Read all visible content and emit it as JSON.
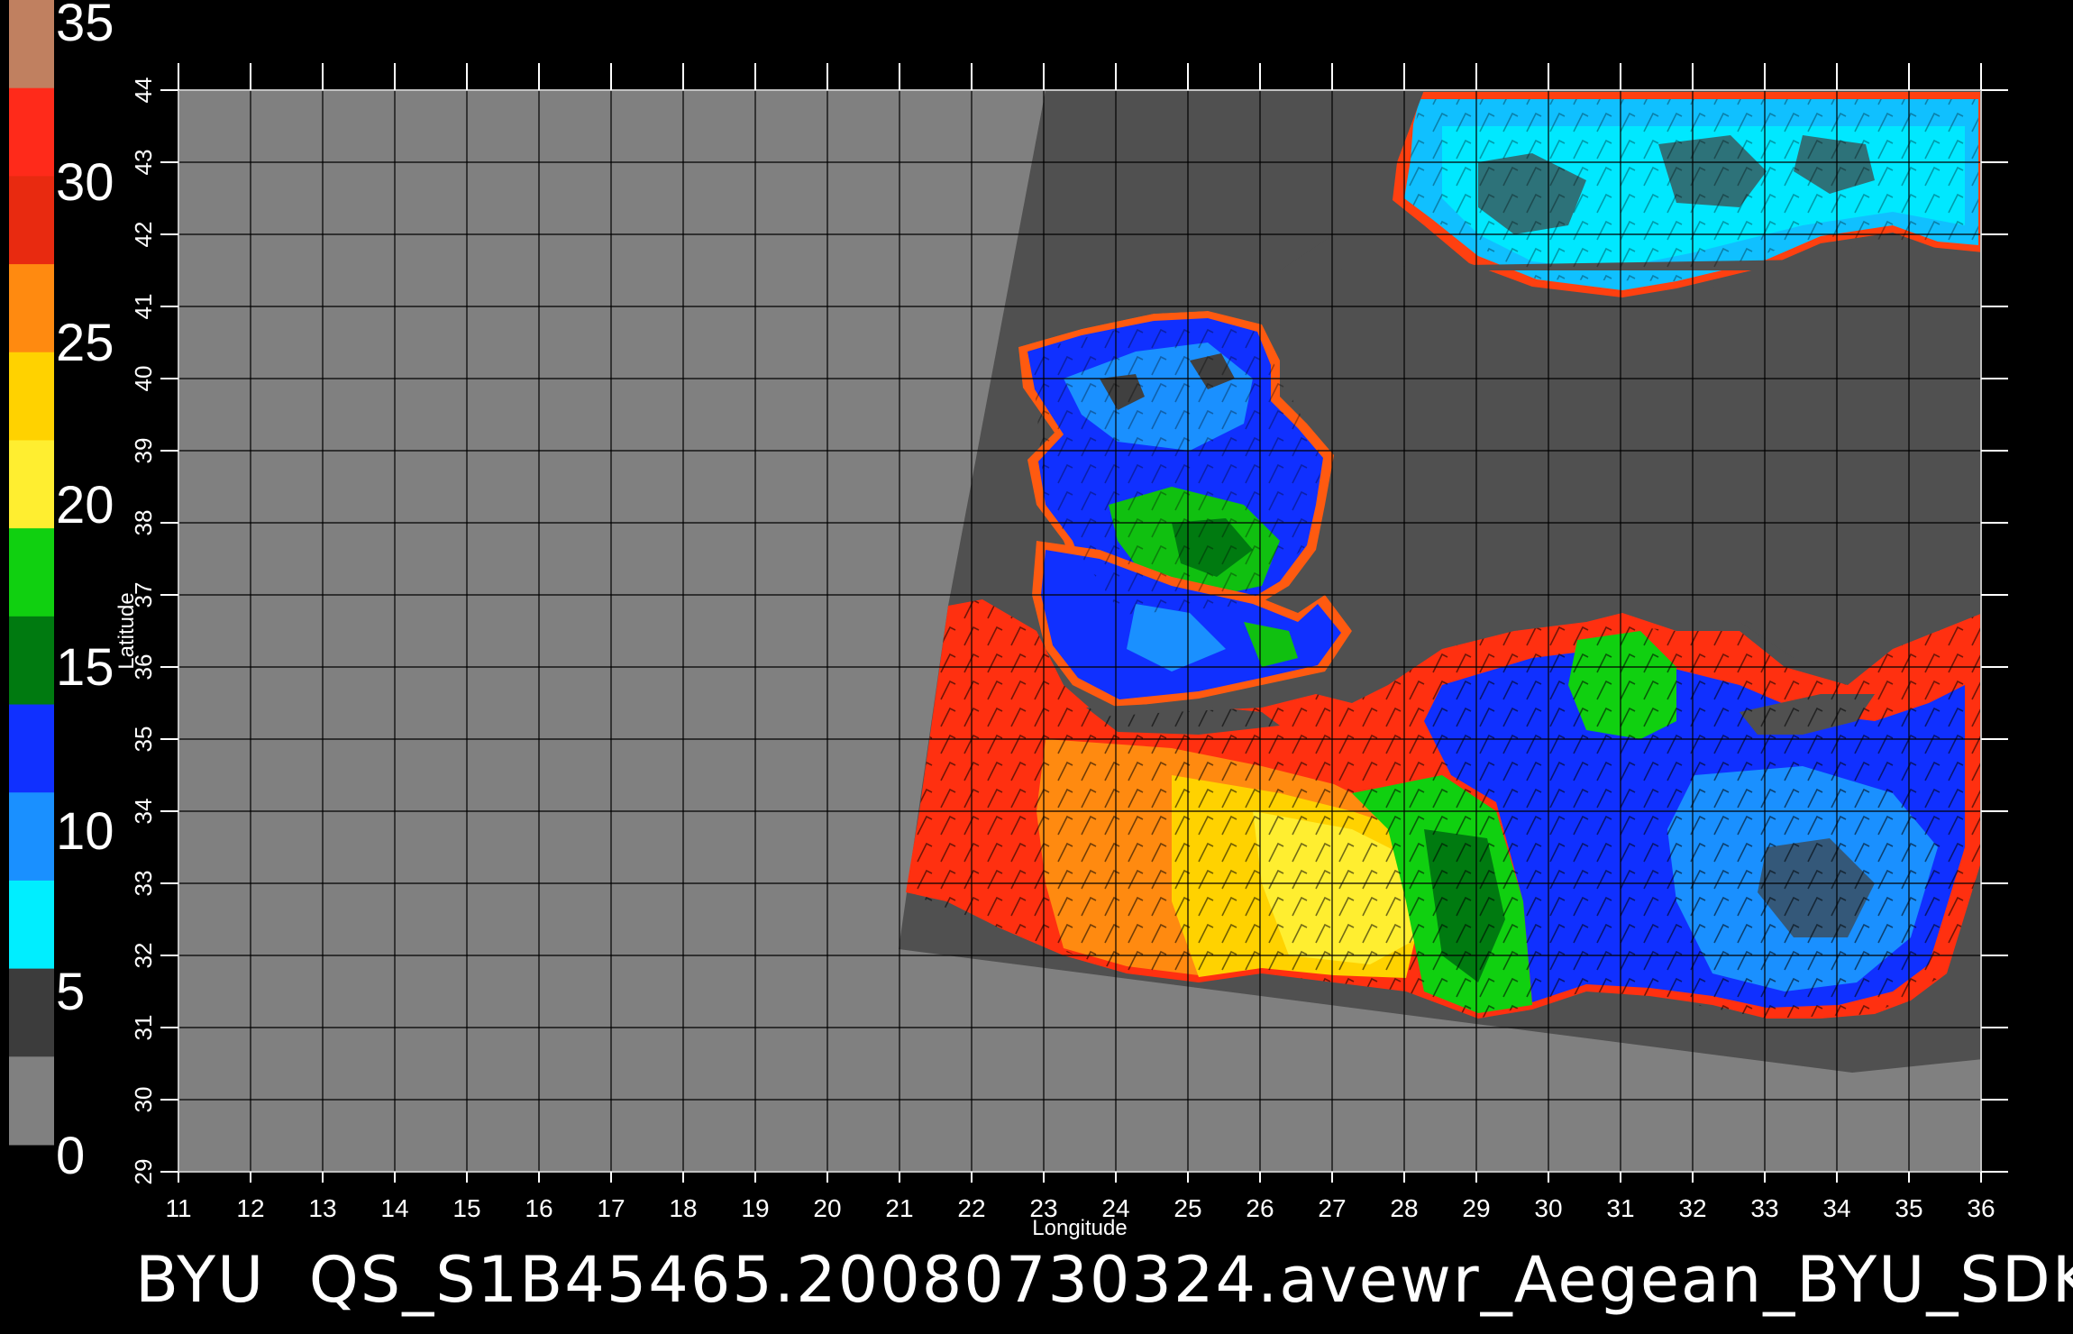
{
  "colorbar": {
    "labels": [
      "35",
      "30",
      "25",
      "20",
      "15",
      "10",
      "5",
      "0"
    ],
    "colors": [
      "#c08060",
      "#ff2a1a",
      "#e82a10",
      "#ff8a10",
      "#ffd200",
      "#ffee30",
      "#10d010",
      "#007a10",
      "#1030ff",
      "#1a90ff",
      "#00eeff",
      "#3c3c3c",
      "#808080"
    ]
  },
  "x_axis": {
    "label": "Longitude",
    "ticks": [
      "11",
      "12",
      "13",
      "14",
      "15",
      "16",
      "17",
      "18",
      "19",
      "20",
      "21",
      "22",
      "23",
      "24",
      "25",
      "26",
      "27",
      "28",
      "29",
      "30",
      "31",
      "32",
      "33",
      "34",
      "35",
      "36"
    ]
  },
  "y_axis": {
    "label": "Latitude",
    "ticks": [
      "29",
      "30",
      "31",
      "32",
      "33",
      "34",
      "35",
      "36",
      "37",
      "38",
      "39",
      "40",
      "41",
      "42",
      "43",
      "44"
    ]
  },
  "caption": "BYU  QS_S1B45465.20080730324.avewr_Aegean_BYU_SDK",
  "colors": {
    "background": "#000000",
    "no_data": "#808080",
    "land_in_swath": "#505050",
    "grid": "#000000",
    "text": "#ffffff"
  }
}
